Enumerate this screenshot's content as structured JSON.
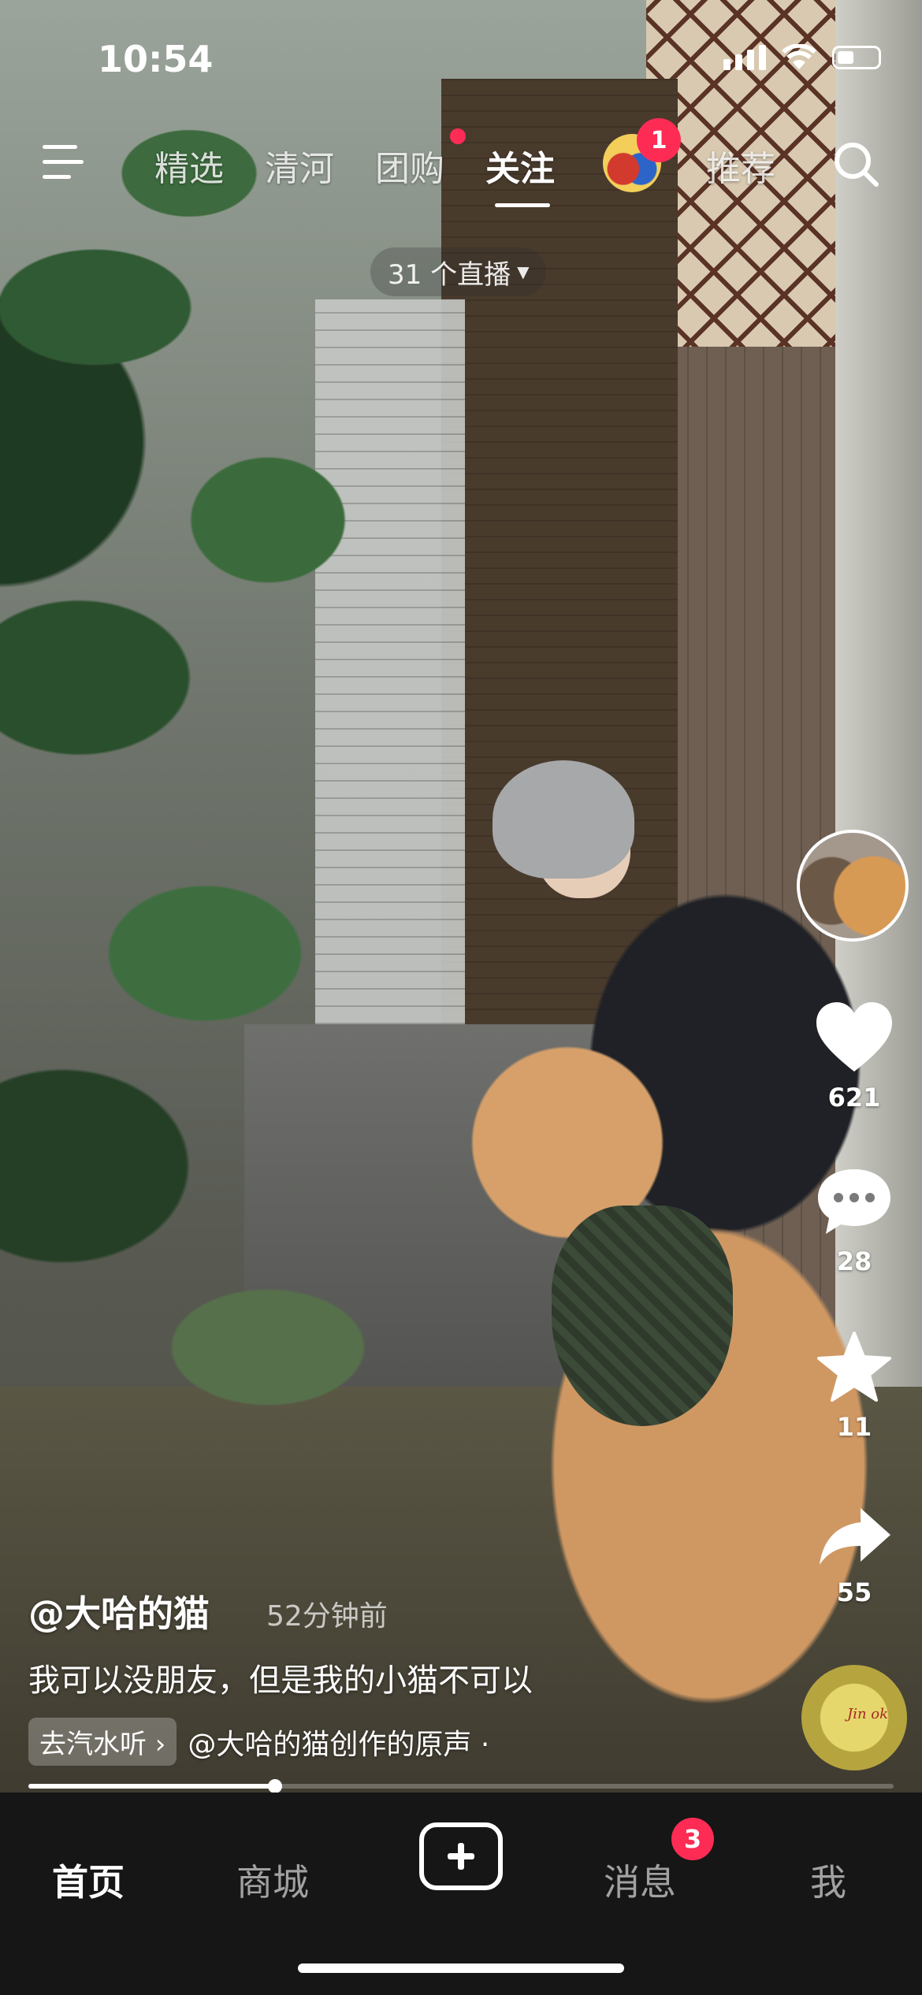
{
  "status": {
    "time": "10:54"
  },
  "nav": {
    "tabs": [
      {
        "label": "精选"
      },
      {
        "label": "清河"
      },
      {
        "label": "团购"
      },
      {
        "label": "关注",
        "active": true
      },
      {
        "label": "推荐"
      }
    ],
    "avatar_badge": "1",
    "live_pill": "31 个直播"
  },
  "rail": {
    "likes": "621",
    "comments": "28",
    "favorites": "11",
    "shares": "55",
    "music_disc_text": "Jin ok"
  },
  "post": {
    "author": "@大哈的猫",
    "time_ago": "52分钟前",
    "caption": "我可以没朋友，但是我的小猫不可以",
    "music_tag": "去汽水听 ›",
    "music_text": "@大哈的猫创作的原声 ·",
    "progress": 0.285
  },
  "bottom": {
    "tabs": [
      {
        "label": "首页",
        "active": true
      },
      {
        "label": "商城"
      },
      {
        "label": "消息"
      },
      {
        "label": "我"
      }
    ],
    "message_badge": "3"
  },
  "colors": {
    "accent": "#fe2c55",
    "bar_bg": "#161616"
  }
}
